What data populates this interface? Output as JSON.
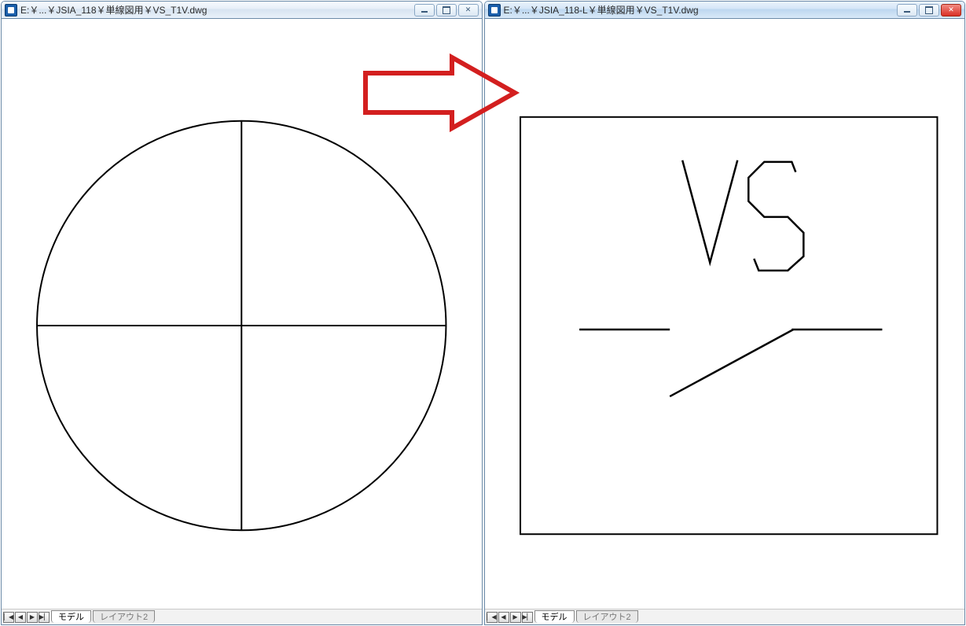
{
  "windows": {
    "left": {
      "title": "E:￥...￥JSIA_118￥単線図用￥VS_T1V.dwg",
      "tab_model": "モデル",
      "tab_layout": "レイアウト2"
    },
    "right": {
      "title": "E:￥...￥JSIA_118-L￥単線図用￥VS_T1V.dwg",
      "tab_model": "モデル",
      "tab_layout": "レイアウト2"
    }
  },
  "drawing": {
    "right_label": "VS"
  },
  "colors": {
    "arrow": "#d31f1f",
    "stroke": "#000000"
  },
  "nav_glyphs": {
    "first": "▏◀",
    "prev": "◀",
    "next": "▶",
    "last": "▶▏"
  }
}
